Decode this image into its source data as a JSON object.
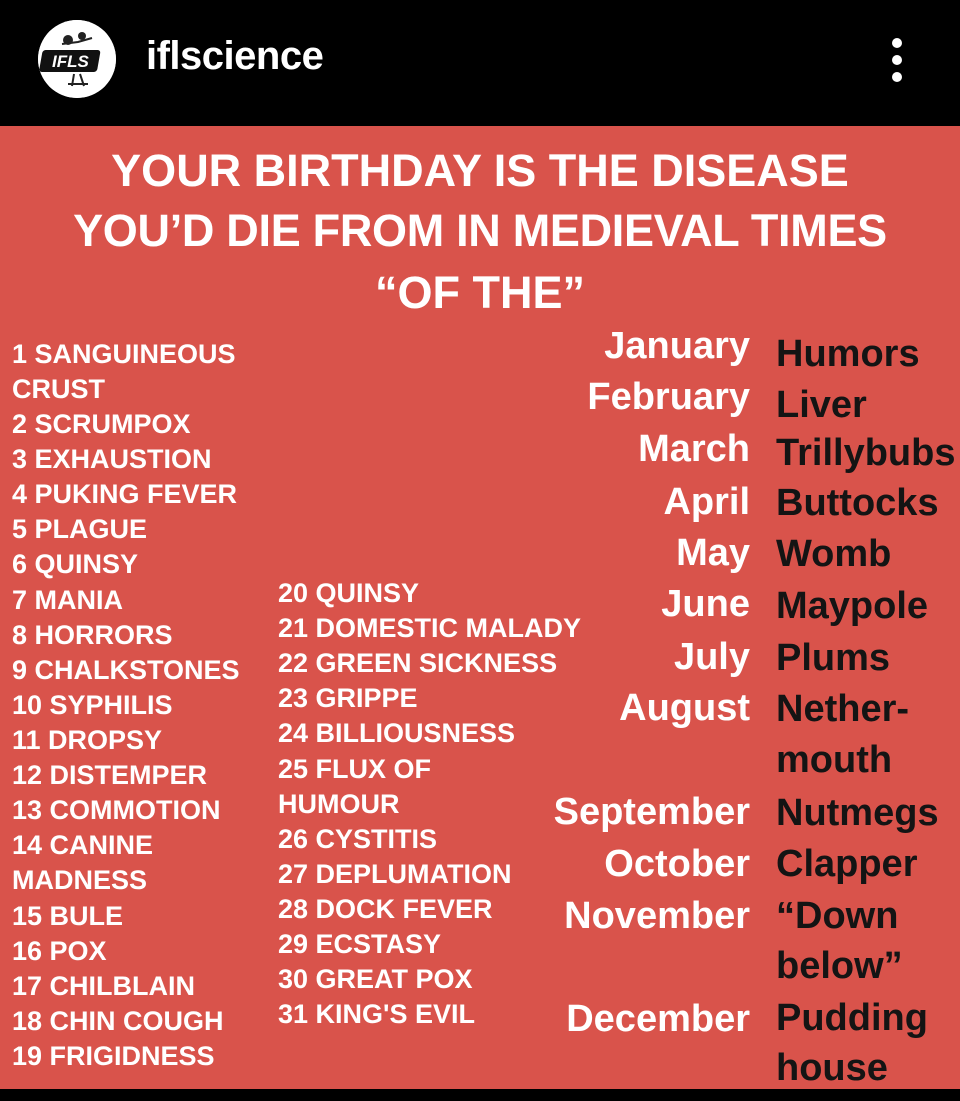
{
  "header": {
    "avatar_text": "IFLS",
    "username": "iflscience",
    "more_icon": "more-vertical-icon"
  },
  "post": {
    "title_line1": "YOUR BIRTHDAY IS THE DISEASE",
    "title_line2": "YOU’D DIE FROM IN MEDIEVAL TIMES",
    "connector": "“OF THE”",
    "background_color": "#d9534b",
    "days": [
      "1 SANGUINEOUS",
      "CRUST",
      "2 SCRUMPOX",
      "3 EXHAUSTION",
      "4 PUKING FEVER",
      "5 PLAGUE",
      "6 QUINSY",
      "7 MANIA",
      "8 HORRORS",
      "9 CHALKSTONES",
      "10 SYPHILIS",
      "11 DROPSY",
      "12 DISTEMPER",
      "13 COMMOTION",
      "14 CANINE",
      "MADNESS",
      "15 BULE",
      "16 POX",
      "17 CHILBLAIN",
      "18 CHIN COUGH",
      "19 FRIGIDNESS",
      "20 QUINSY",
      "21 DOMESTIC MALADY",
      "22 GREEN SICKNESS",
      "23 GRIPPE",
      "24 BILLIOUSNESS",
      "25 FLUX OF",
      "HUMOUR",
      "26 CYSTITIS",
      "27 DEPLUMATION",
      "28 DOCK FEVER",
      "29 ECSTASY",
      "30 GREAT POX",
      "31 KING'S EVIL"
    ],
    "months": [
      "January",
      "February",
      "March",
      "April",
      "May",
      "June",
      "July",
      "August",
      "September",
      "October",
      "November",
      "December"
    ],
    "parts": [
      "Humors",
      "Liver",
      "Trillybubs",
      "Buttocks",
      "Womb",
      "Maypole",
      "Plums",
      "Nether-",
      "mouth",
      "Nutmegs",
      "Clapper",
      "“Down",
      "below”",
      "Pudding",
      "house"
    ]
  }
}
